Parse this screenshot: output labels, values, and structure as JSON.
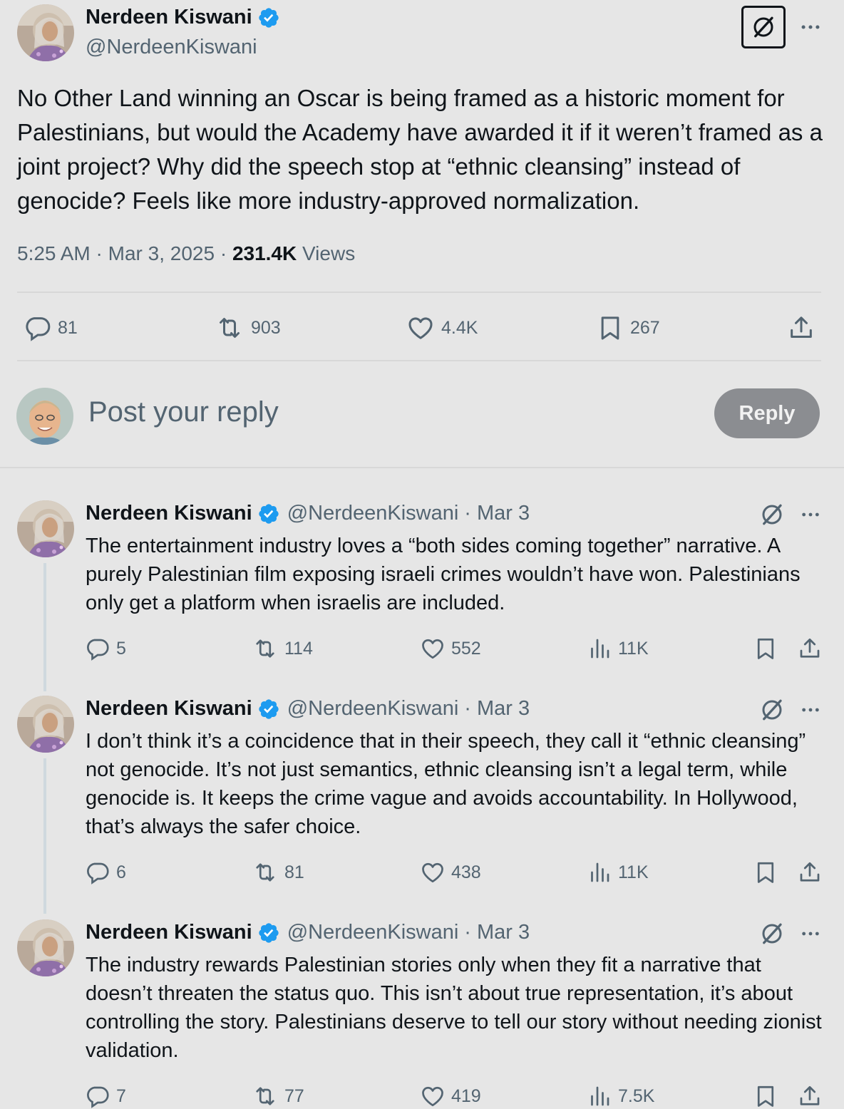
{
  "main_post": {
    "author_name": "Nerdeen Kiswani",
    "handle": "@NerdeenKiswani",
    "text": "No Other Land winning an Oscar is being framed as a historic moment for Palestinians, but would the Academy have awarded it if it weren’t framed as a joint project? Why did the speech stop at “ethnic cleansing” instead of genocide? Feels like more industry-approved normalization.",
    "time": "5:25 AM",
    "date": "Mar 3, 2025",
    "views_count": "231.4K",
    "views_label": "Views",
    "replies": "81",
    "reposts": "903",
    "likes": "4.4K",
    "bookmarks": "267"
  },
  "composer": {
    "placeholder": "Post your reply",
    "button_label": "Reply"
  },
  "replies": [
    {
      "author_name": "Nerdeen Kiswani",
      "handle": "@NerdeenKiswani",
      "date": "Mar 3",
      "text": "The entertainment industry loves a “both sides coming together” narrative. A purely Palestinian film exposing israeli crimes wouldn’t have won. Palestinians only get a platform when israelis are included.",
      "replies": "5",
      "reposts": "114",
      "likes": "552",
      "views": "11K"
    },
    {
      "author_name": "Nerdeen Kiswani",
      "handle": "@NerdeenKiswani",
      "date": "Mar 3",
      "text": "I don’t think it’s a coincidence that in their speech, they call it “ethnic cleansing” not genocide. It’s not just semantics, ethnic cleansing isn’t a legal term, while genocide is. It keeps the crime vague and avoids accountability. In Hollywood, that’s always the safer choice.",
      "replies": "6",
      "reposts": "81",
      "likes": "438",
      "views": "11K"
    },
    {
      "author_name": "Nerdeen Kiswani",
      "handle": "@NerdeenKiswani",
      "date": "Mar 3",
      "text": "The industry rewards Palestinian stories only when they fit a narrative that doesn’t threaten the status quo. This isn’t about true representation, it’s about controlling the story. Palestinians deserve to tell our story without needing zionist validation.",
      "replies": "7",
      "reposts": "77",
      "likes": "419",
      "views": "7.5K"
    }
  ],
  "colors": {
    "background": "#e6e6e6",
    "verified_badge": "#1d9bf0",
    "secondary_text": "#536471",
    "reply_button": "#8b8d91"
  },
  "icons": [
    "verified-badge-icon",
    "grok-icon",
    "more-icon",
    "reply-icon",
    "repost-icon",
    "like-icon",
    "bookmark-icon",
    "share-icon",
    "views-icon"
  ]
}
